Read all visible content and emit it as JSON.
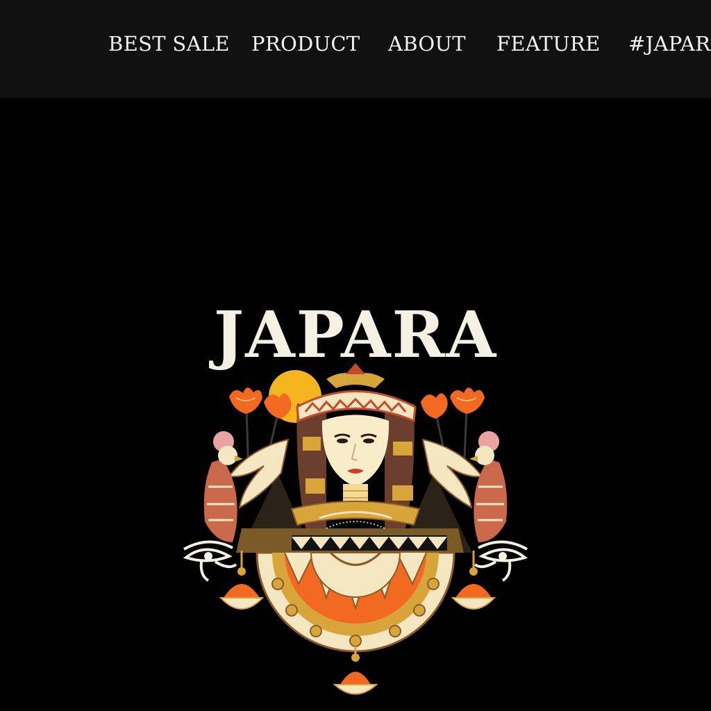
{
  "nav": {
    "items": [
      {
        "label": "BEST SALE"
      },
      {
        "label": "PRODUCT"
      },
      {
        "label": "ABOUT"
      },
      {
        "label": "FEATURE"
      },
      {
        "label": "#JAPARA"
      }
    ]
  },
  "hero": {
    "brand": "JAPARA"
  },
  "colors": {
    "nav_bg": "#111111",
    "page_bg": "#000000",
    "nav_text": "#f2f2f2",
    "brand_text": "#f4f1e4",
    "accent_orange": "#f26a21",
    "sun_yellow": "#f5b51f",
    "gold": "#d8a53a",
    "hair_brown": "#6b3e2e",
    "cream": "#f3e6c0"
  },
  "icons": [
    "eye-of-horus-icon",
    "lotus-flower-icon",
    "falcon-icon",
    "sun-disc-icon",
    "pyramid-icon"
  ]
}
